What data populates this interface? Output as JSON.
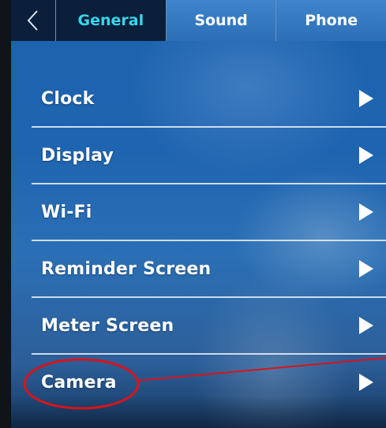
{
  "tabs": {
    "back_icon": "chevron-left-icon",
    "items": [
      {
        "label": "General",
        "active": true
      },
      {
        "label": "Sound",
        "active": false
      },
      {
        "label": "Phone",
        "active": false
      }
    ]
  },
  "menu": {
    "items": [
      {
        "label": "Clock",
        "icon": "triangle-right-icon"
      },
      {
        "label": "Display",
        "icon": "triangle-right-icon"
      },
      {
        "label": "Wi-Fi",
        "icon": "triangle-right-icon"
      },
      {
        "label": "Reminder Screen",
        "icon": "triangle-right-icon"
      },
      {
        "label": "Meter Screen",
        "icon": "triangle-right-icon"
      },
      {
        "label": "Camera",
        "icon": "triangle-right-icon"
      }
    ]
  },
  "colors": {
    "active_tab_text": "#38d6ec",
    "background": "#1f64b0",
    "annotation": "#d8141a"
  }
}
